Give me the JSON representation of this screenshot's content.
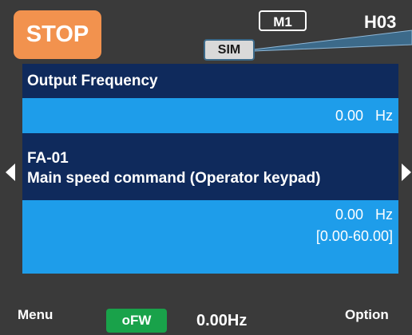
{
  "status": {
    "stop_label": "STOP",
    "mode_badge": "M1",
    "code": "H03",
    "sim_badge": "SIM"
  },
  "monitor": {
    "title": "Output Frequency",
    "value": "0.00",
    "unit": "Hz"
  },
  "parameter": {
    "code": "FA-01",
    "name": "Main speed command (Operator keypad)",
    "value": "0.00",
    "unit": "Hz",
    "range": "[0.00-60.00]"
  },
  "footer": {
    "menu_label": "Menu",
    "ofw_badge": "oFW",
    "frequency": "0.00Hz",
    "option_label": "Option"
  },
  "colors": {
    "background": "#3a3a3a",
    "stop_orange": "#f2924e",
    "panel_navy": "#0f2a5c",
    "panel_blue": "#1e9dea",
    "ofw_green": "#19a24a"
  }
}
